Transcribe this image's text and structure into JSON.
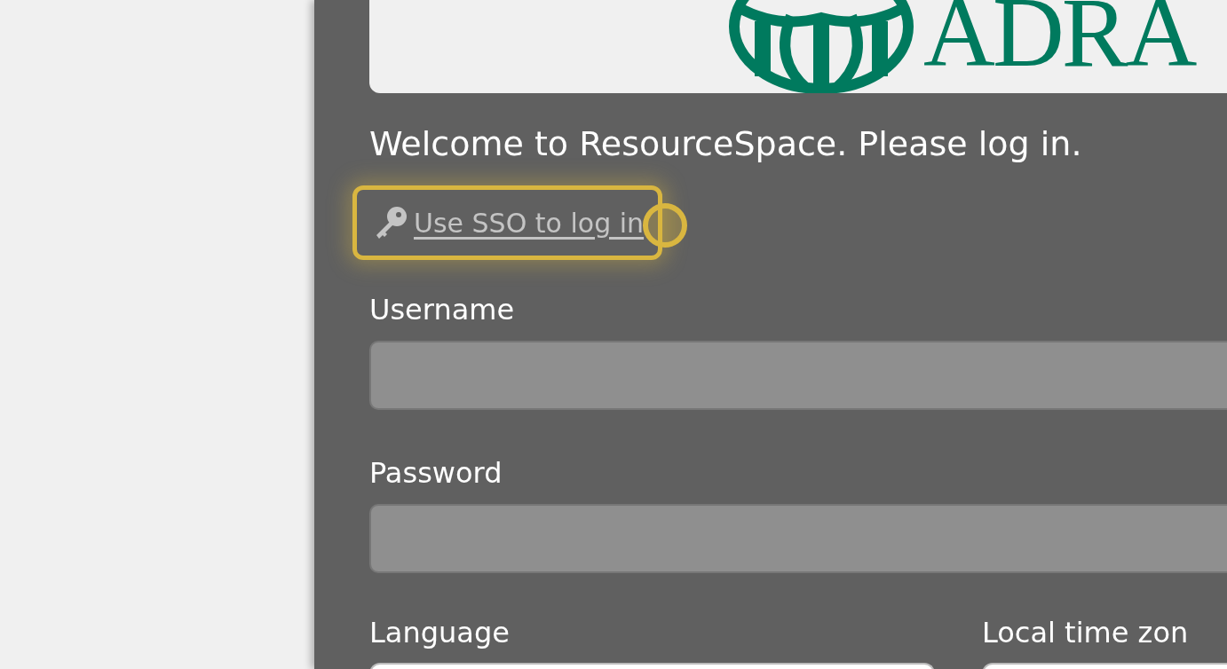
{
  "logo": {
    "text": "ADRA"
  },
  "welcome": "Welcome to ResourceSpace. Please log in.",
  "sso_link": {
    "label": "Use SSO to log in",
    "highlighted": true
  },
  "fields": [
    {
      "label": "Username"
    },
    {
      "label": "Password"
    }
  ],
  "selects": [
    {
      "label": "Language"
    },
    {
      "label": "Local time zon"
    }
  ]
}
